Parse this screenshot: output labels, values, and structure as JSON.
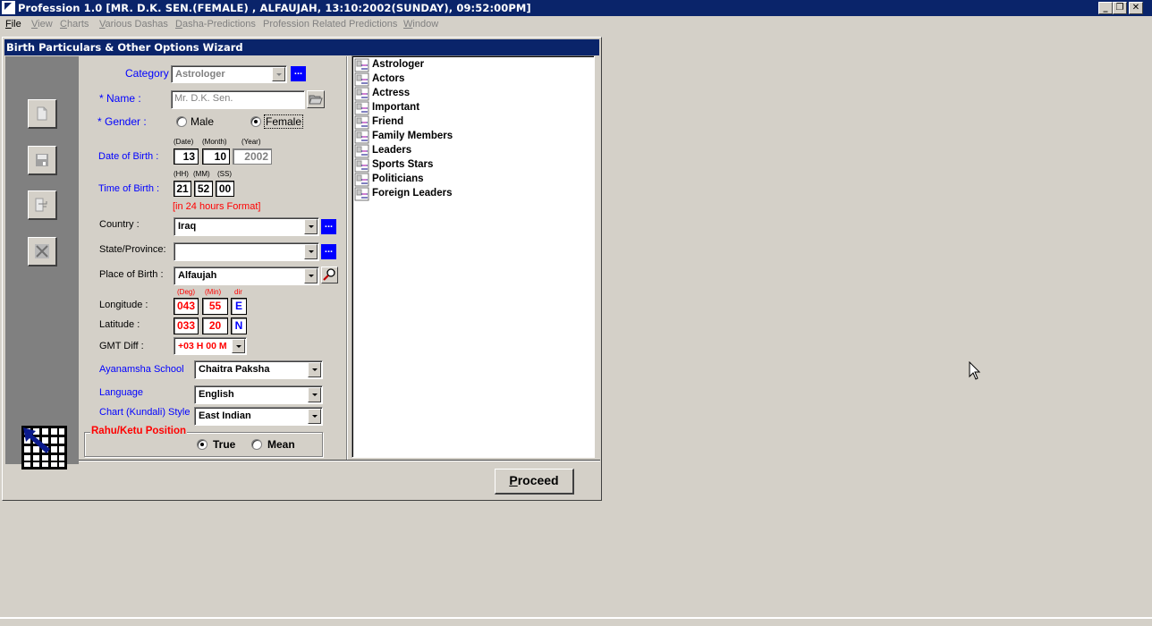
{
  "window": {
    "title": "Profession 1.0 [MR. D.K. SEN.(FEMALE) , ALFAUJAH, 13:10:2002(SUNDAY), 09:52:00PM]",
    "controls": {
      "minimize": "_",
      "restore": "❐",
      "close": "✕"
    }
  },
  "menu": [
    {
      "label": "File",
      "accel": "F",
      "rest": "ile",
      "enabled": true
    },
    {
      "label": "View",
      "accel": "V",
      "rest": "iew",
      "enabled": false
    },
    {
      "label": "Charts",
      "accel": "C",
      "rest": "harts",
      "enabled": false
    },
    {
      "label": "Various Dashas",
      "accel": "V",
      "rest": "arious Dashas",
      "enabled": false
    },
    {
      "label": "Dasha-Predictions",
      "accel": "D",
      "rest": "asha-Predictions",
      "enabled": false
    },
    {
      "label": "Profession Related Predictions",
      "accel": "",
      "rest": "Profession Related Predictions",
      "enabled": false
    },
    {
      "label": "Window",
      "accel": "W",
      "rest": "indow",
      "enabled": false
    }
  ],
  "wizard": {
    "title": "Birth Particulars & Other Options Wizard",
    "side_buttons": [
      {
        "name": "new",
        "icon": "new-document-icon"
      },
      {
        "name": "save",
        "icon": "save-disk-icon"
      },
      {
        "name": "edit",
        "icon": "edit-record-icon"
      },
      {
        "name": "delete",
        "icon": "delete-x-icon"
      }
    ],
    "form": {
      "category": {
        "label": "Category :",
        "value": "Astrologer",
        "more": "..."
      },
      "name": {
        "label": "* Name :",
        "value": "Mr. D.K. Sen."
      },
      "gender": {
        "label": "* Gender :",
        "options": [
          "Male",
          "Female"
        ],
        "selected": "Female"
      },
      "dob": {
        "label": "Date of Birth :",
        "hints": {
          "date": "(Date)",
          "month": "(Month)",
          "year": "(Year)"
        },
        "date": "13",
        "month": "10",
        "year": "2002"
      },
      "tob": {
        "label": "Time of Birth :",
        "hints": {
          "hh": "(HH)",
          "mm": "(MM)",
          "ss": "(SS)"
        },
        "hh": "21",
        "mm": "52",
        "ss": "00",
        "note": "[in 24 hours Format]"
      },
      "country": {
        "label": "Country :",
        "value": "Iraq",
        "more": "..."
      },
      "state": {
        "label": "State/Province:",
        "value": "",
        "more": "..."
      },
      "place": {
        "label": "Place of Birth :",
        "value": "Alfaujah"
      },
      "coord_hints": {
        "deg": "(Deg)",
        "min": "(Min)",
        "dir": "dir"
      },
      "longitude": {
        "label": "Longitude :",
        "deg": "043",
        "min": "55",
        "dir": "E"
      },
      "latitude": {
        "label": "Latitude :",
        "deg": "033",
        "min": "20",
        "dir": "N"
      },
      "gmt": {
        "label": "GMT Diff :",
        "value": "+03 H 00 M"
      },
      "ayanamsha": {
        "label": "Ayanamsha School",
        "value": "Chaitra Paksha"
      },
      "language": {
        "label": "Language",
        "value": "English"
      },
      "chart_style": {
        "label": "Chart (Kundali) Style",
        "value": "East Indian"
      },
      "rahu_ketu": {
        "legend": "Rahu/Ketu Position",
        "options": [
          "True",
          "Mean"
        ],
        "selected": "True"
      }
    },
    "categories": [
      "Astrologer",
      "Actors",
      "Actress",
      "Important",
      "Friend",
      "Family Members",
      "Leaders",
      "Sports Stars",
      "Politicians",
      "Foreign Leaders"
    ],
    "proceed": {
      "accel": "P",
      "rest": "roceed",
      "label": "Proceed"
    }
  },
  "colors": {
    "titlebar": "#0a246a",
    "face": "#d4d0c8",
    "label_blue": "#0000ff",
    "accent_red": "#ff0000",
    "more_button": "#0000ff"
  }
}
